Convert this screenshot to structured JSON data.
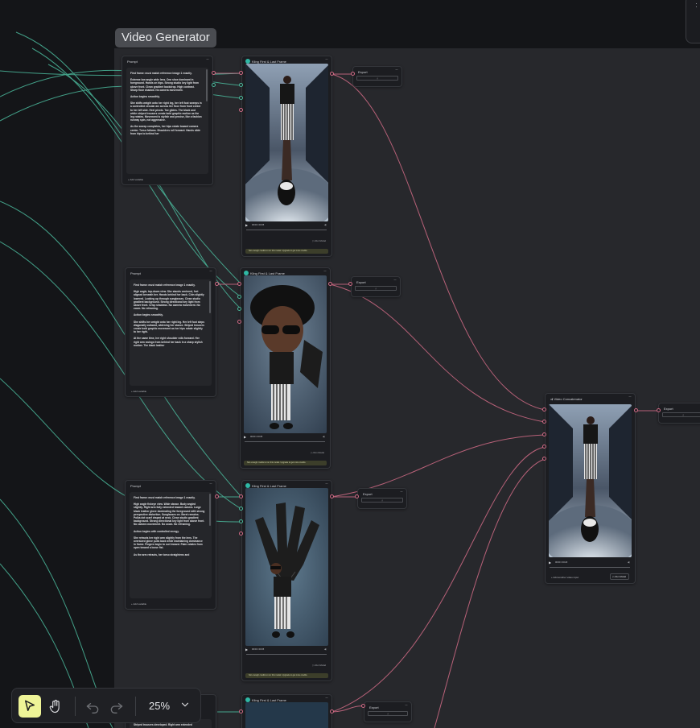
{
  "group": {
    "title": "Video Generator"
  },
  "prompt_nodes": [
    {
      "title": "Prompt",
      "menu": "···",
      "paragraphs": [
        "First frame: must match reference image 1 exactly.",
        "Extreme low angle wide lens. One shoe dominant in foreground. Hands on hips. Strong studio key light from above front. Clean gradient backdrop. High contrast. Sharp floor shadow. No camera movement.",
        "Action begins smoothly.",
        "She shifts weight onto her right leg, her left foot sweeps in a controlled circular arc across the floor from front center to her left side. Heel pivots. Toe glides. The black and white striped trousers create bold graphic motion as the leg rotates. Movement is stylish and precise, like a fashion runway spin, not aggressive.",
        "As the sweep completes, her hips rotate toward camera center. Torso follows. Shoulders roll forward. Hands slide from hips to behind her"
      ],
      "add_variable": "Add variable"
    },
    {
      "title": "Prompt",
      "menu": "···",
      "paragraphs": [
        "First frame: must match reference image 1 exactly.",
        "High angle, top-down view. She stands centered, feet aligned beneath her. Hands behind her back. Chin slightly lowered. Looking up through sunglasses. Clean studio gradient background. Strong directional key light from above front. Crisp shadows. No camera movement. No zoom. No reframing.",
        "Action begins smoothly.",
        "She shifts her weight onto her right leg. Her left foot steps diagonally outward, widening her stance. Striped trousers create bold graphic movement as her hips rotate slightly to her right.",
        "At the same time, her right shoulder rolls forward. Her right arm swings from behind her back in a sharp stylish motion. The black leather"
      ],
      "add_variable": "Add variable"
    },
    {
      "title": "Prompt",
      "menu": "···",
      "paragraphs": [
        "First frame: must match reference image 1 exactly.",
        "High angle fisheye view. Wide stance. Body angled slightly. Right arm fully extended toward camera. Large black leather glove dominating the foreground with strong perspective distortion. Sunglasses on. Beret remains. Polka dot scarf draped at neck. Clean studio gradient background. Strong directional key light from above front. No camera movement. No zoom. No reframing.",
        "Action begins with controlled energy.",
        "She retracts her right arm slightly from the lens. The oversized glove pulls back while maintaining dominance in frame. Fingers begin to curl inward. Palm rotates from open toward a loose fist.",
        "As the arm retracts, her torso straightens and"
      ],
      "add_variable": "Add variable"
    },
    {
      "title": "",
      "menu": "",
      "paragraphs": [
        "Striped trousers developed. Right arm extended"
      ],
      "add_variable": ""
    }
  ],
  "kling_nodes": [
    {
      "title": "Kling First & Last Frame",
      "menu": "···",
      "time": "00:00 / 00:05",
      "run_label": "Run Model",
      "credit_text": "Not enough credits to run this model. Upgrade to get more credits."
    },
    {
      "title": "Kling First & Last Frame",
      "menu": "···",
      "time": "00:00 / 00:05",
      "run_label": "Run Model",
      "credit_text": "Not enough credits to run this model. Upgrade to get more credits."
    },
    {
      "title": "Kling First & Last Frame",
      "menu": "···",
      "time": "00:00 / 00:05",
      "run_label": "Run Model",
      "credit_text": "Not enough credits to run this model. Upgrade to get more credits."
    },
    {
      "title": "Kling First & Last Frame",
      "menu": "···",
      "time": "",
      "run_label": "",
      "credit_text": ""
    }
  ],
  "export_nodes": [
    {
      "title": "Export",
      "menu": "···",
      "icon": "download-icon"
    },
    {
      "title": "Export",
      "menu": "···",
      "icon": "download-icon"
    },
    {
      "title": "Export",
      "menu": "···",
      "icon": "download-icon"
    },
    {
      "title": "Export",
      "menu": "···",
      "icon": "download-icon"
    },
    {
      "title": "Export",
      "menu": "···",
      "icon": "download-icon"
    }
  ],
  "concat_node": {
    "title": "Video Concatenator",
    "menu": "···",
    "time": "00:00 / 00:20",
    "add_input": "Add another video input",
    "run_label": "Run Model"
  },
  "toolbar": {
    "zoom": "25%",
    "select_icon": "cursor-arrow-icon",
    "pan_icon": "hand-icon",
    "undo_icon": "undo-icon",
    "redo_icon": "redo-icon",
    "zoom_icon": "chevron-down-icon"
  },
  "colors": {
    "canvas": "#141518",
    "group": "#27282c",
    "node": "#1c1d21",
    "wire_text": "#4bb99c",
    "wire_video": "#d16b86",
    "active_tool": "#eef497"
  }
}
